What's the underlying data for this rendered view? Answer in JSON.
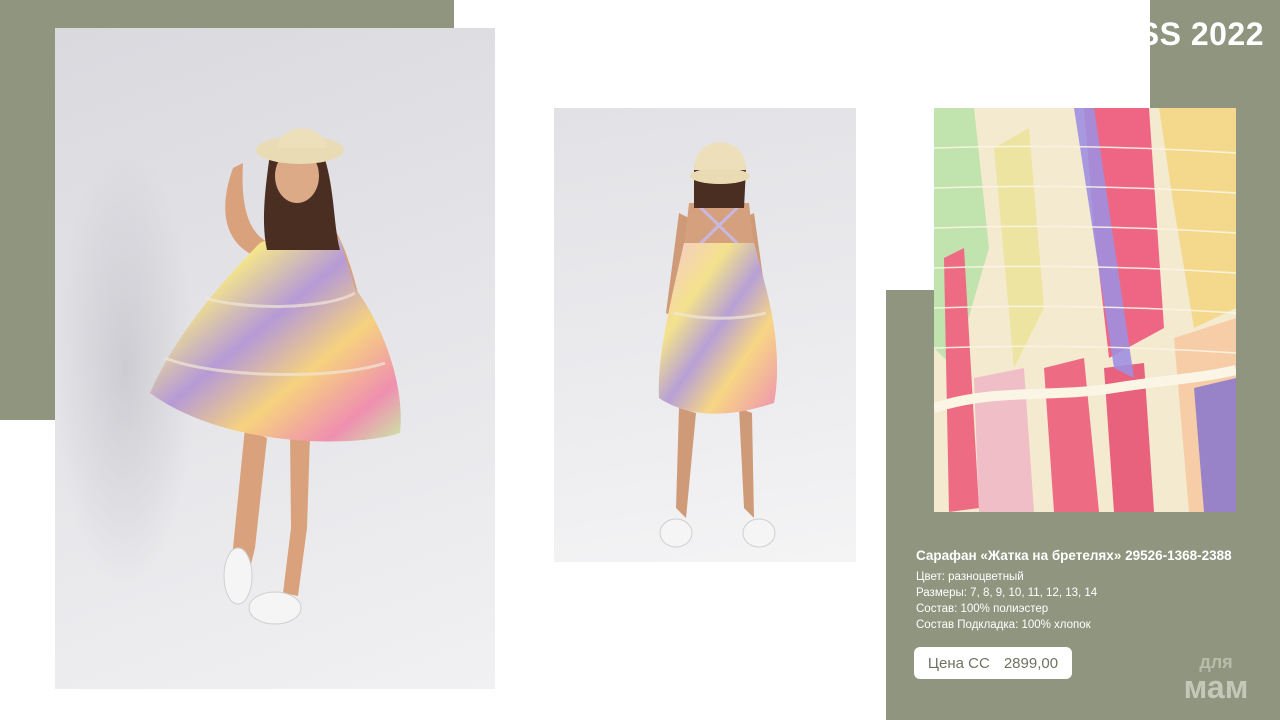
{
  "header": {
    "season": "SS 2022"
  },
  "product": {
    "title": "Сарафан «Жатка на бретелях» 29526-1368-2388",
    "color_line": "Цвет: разноцветный",
    "sizes_line": "Размеры: 7, 8, 9, 10, 11, 12, 13, 14",
    "composition_line": "Состав: 100%  полиэстер",
    "lining_line": "Состав Подкладка: 100% хлопок"
  },
  "price": {
    "label": "Цена СС",
    "value": "2899,00"
  },
  "logo": {
    "line1": "для",
    "line2": "мам"
  },
  "colors": {
    "olive": "#8f957f",
    "white": "#ffffff"
  }
}
